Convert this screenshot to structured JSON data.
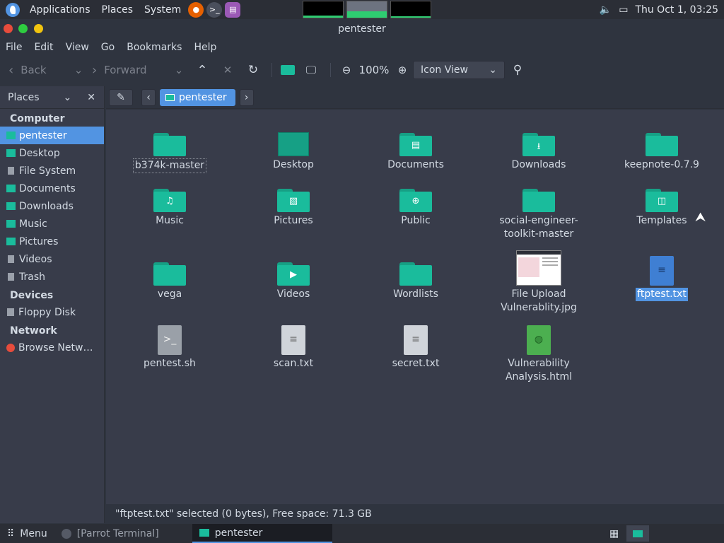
{
  "topbar": {
    "menus": [
      "Applications",
      "Places",
      "System"
    ],
    "clock": "Thu Oct  1, 03:25"
  },
  "window": {
    "title": "pentester"
  },
  "menubar": [
    "File",
    "Edit",
    "View",
    "Go",
    "Bookmarks",
    "Help"
  ],
  "toolbar": {
    "back": "Back",
    "forward": "Forward",
    "zoom": "100%",
    "view_mode": "Icon View"
  },
  "sidebar": {
    "title": "Places",
    "groups": [
      {
        "label": "Computer",
        "items": [
          "pentester",
          "Desktop",
          "File System",
          "Documents",
          "Downloads",
          "Music",
          "Pictures",
          "Videos",
          "Trash"
        ]
      },
      {
        "label": "Devices",
        "items": [
          "Floppy Disk"
        ]
      },
      {
        "label": "Network",
        "items": [
          "Browse Netw…"
        ]
      }
    ],
    "selected": "pentester"
  },
  "pathbar": {
    "crumb": "pentester"
  },
  "files": [
    {
      "name": "b374k-master",
      "kind": "folder"
    },
    {
      "name": "Desktop",
      "kind": "desktop"
    },
    {
      "name": "Documents",
      "kind": "folder",
      "glyph": "▤"
    },
    {
      "name": "Downloads",
      "kind": "folder",
      "glyph": "⭳"
    },
    {
      "name": "keepnote-0.7.9",
      "kind": "folder"
    },
    {
      "name": "Music",
      "kind": "folder",
      "glyph": "♫"
    },
    {
      "name": "Pictures",
      "kind": "folder",
      "glyph": "▨"
    },
    {
      "name": "Public",
      "kind": "folder",
      "glyph": "⊕"
    },
    {
      "name": "social-engineer-toolkit-master",
      "kind": "folder"
    },
    {
      "name": "Templates",
      "kind": "folder",
      "glyph": "◫"
    },
    {
      "name": "vega",
      "kind": "folder"
    },
    {
      "name": "Videos",
      "kind": "folder",
      "glyph": "▶"
    },
    {
      "name": "Wordlists",
      "kind": "folder"
    },
    {
      "name": "File Upload Vulnerablity.jpg",
      "kind": "image"
    },
    {
      "name": "ftptest.txt",
      "kind": "textdoc"
    },
    {
      "name": "pentest.sh",
      "kind": "script"
    },
    {
      "name": "scan.txt",
      "kind": "text"
    },
    {
      "name": "secret.txt",
      "kind": "text"
    },
    {
      "name": "Vulnerability Analysis.html",
      "kind": "html"
    }
  ],
  "status": "\"ftptest.txt\" selected (0 bytes), Free space: 71.3 GB",
  "taskbar": {
    "menu": "Menu",
    "tasks": [
      "[Parrot Terminal]",
      "pentester"
    ]
  },
  "colors": {
    "accent": "#5294e2",
    "folder": "#1abc9c",
    "background": "#383c4a"
  }
}
